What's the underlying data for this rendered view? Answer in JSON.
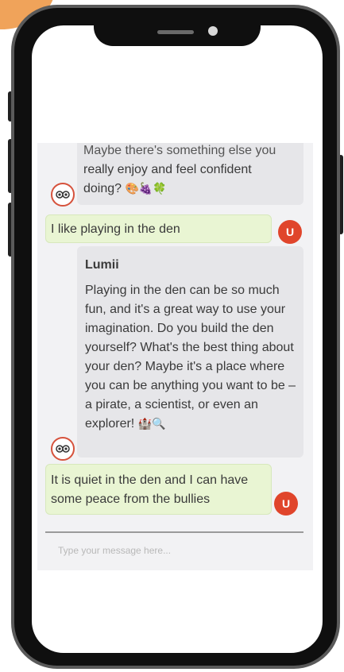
{
  "chat": {
    "messages": [
      {
        "sender": "bot",
        "text_partial": "Maybe there's something else you",
        "text_lines": [
          "really enjoy and feel confident",
          "doing?"
        ],
        "emoji": "🎨🍇🍀"
      },
      {
        "sender": "user",
        "avatar_letter": "U",
        "text": "I like playing in the den"
      },
      {
        "sender": "bot",
        "name": "Lumii",
        "text": "Playing in the den can be so much fun, and it's a great way to use your imagination. Do you build the den yourself? What's the best thing about your den? Maybe it's a place where you can be anything you want to be – a pirate, a scientist, or even an explorer!",
        "emoji": "🏰🔍"
      },
      {
        "sender": "user",
        "avatar_letter": "U",
        "text": "It is quiet in the den and I can have some peace from the bullies"
      }
    ]
  },
  "composer": {
    "placeholder": "Type your message here..."
  },
  "colors": {
    "bot_bubble": "#e6e6e9",
    "user_bubble": "#e9f5d3",
    "user_avatar": "#e0452b",
    "frame": "#0f0f0f"
  },
  "icons": {
    "bot_avatar": "owl-avatar-icon",
    "user_avatar": "user-initial-avatar"
  }
}
